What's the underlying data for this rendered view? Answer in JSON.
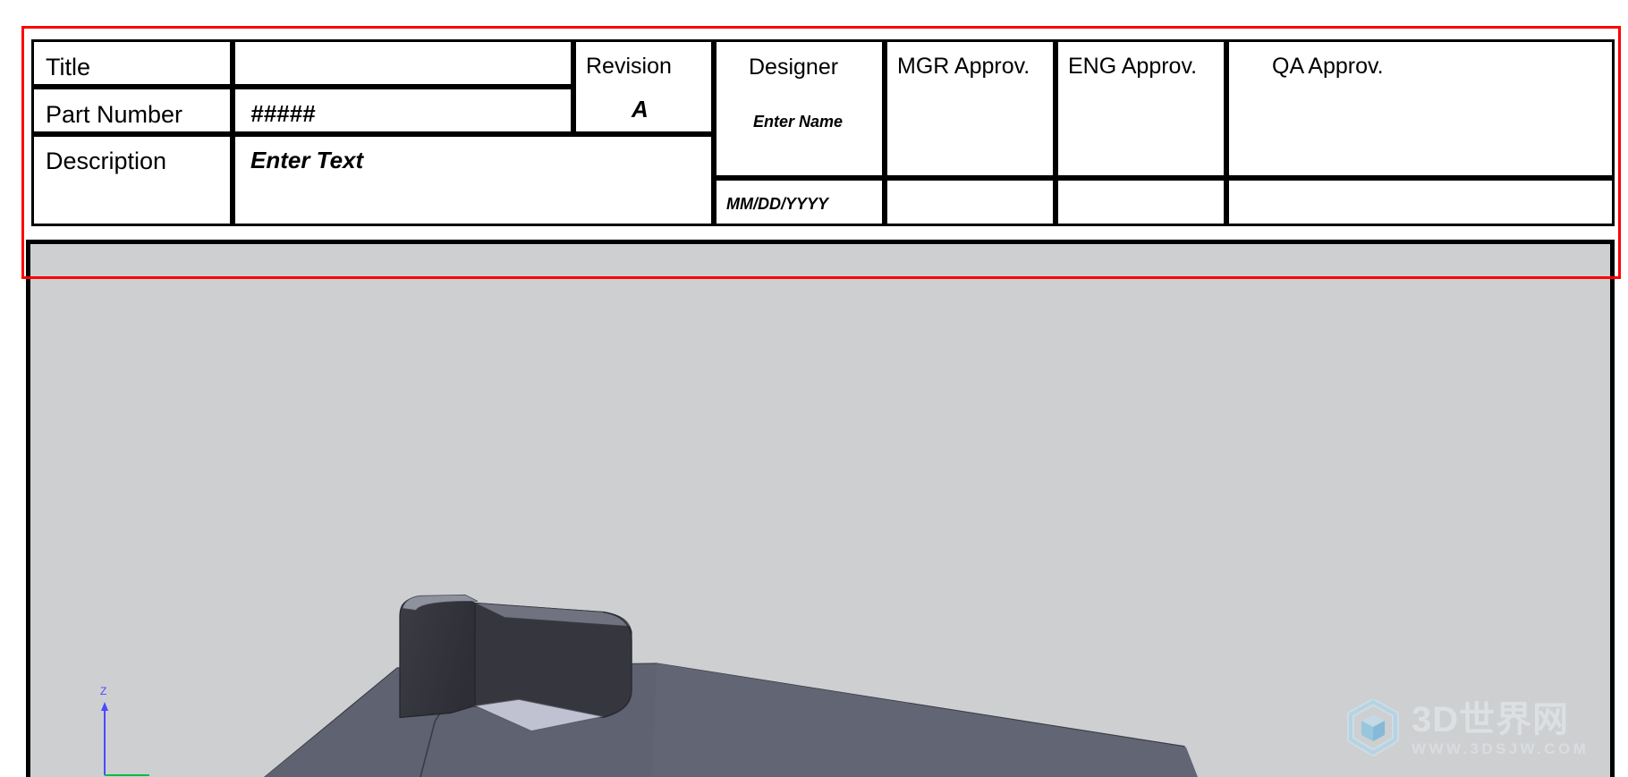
{
  "document": {
    "type": "cad-drawing-title-block"
  },
  "title_block": {
    "rows": {
      "title": {
        "label": "Title",
        "value": ""
      },
      "part_number": {
        "label": "Part Number",
        "value": "#####"
      },
      "description": {
        "label": "Description",
        "value": "Enter Text"
      }
    },
    "revision": {
      "label": "Revision",
      "value": "A"
    },
    "designer": {
      "label": "Designer",
      "value": "Enter Name",
      "date": "MM/DD/YYYY"
    },
    "approvals": [
      {
        "label": "MGR Approv.",
        "value": "",
        "date": ""
      },
      {
        "label": "ENG Approv.",
        "value": "",
        "date": ""
      },
      {
        "label": "QA Approv.",
        "value": "",
        "date": ""
      }
    ]
  },
  "viewport": {
    "background_color": "#cdcfd1",
    "model_name": "sheet-metal-bracket",
    "triad": {
      "z_label": "Z",
      "z_color": "#4a4aff",
      "x_color": "#00bb44"
    }
  },
  "selection": {
    "color": "#ff0000"
  },
  "watermark": {
    "main": "3D世界网",
    "sub": "WWW.3DSJW.COM",
    "logo_color_light": "#cfe8f7",
    "logo_color_mid": "#8fd0ef",
    "logo_color_dark": "#5bb6e4"
  }
}
